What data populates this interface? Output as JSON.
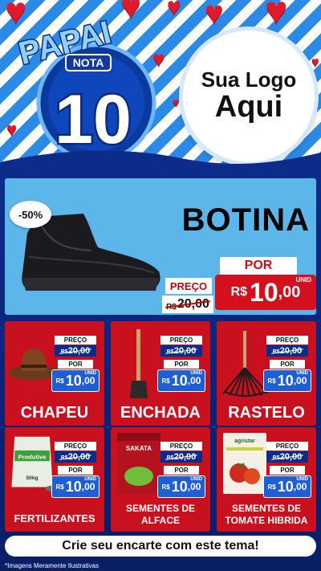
{
  "badge": {
    "line1": "PAPAI",
    "nota": "NOTA",
    "number": "10"
  },
  "logo": {
    "line1": "Sua Logo",
    "line2": "Aqui"
  },
  "featured": {
    "discount": "-50%",
    "name": "BOTINA",
    "preco_label": "PREÇO",
    "old_currency": "R$",
    "old_price": "20,00",
    "por_label": "POR",
    "currency": "R$",
    "price_int": "10",
    "price_dec": ",00",
    "unit": "UNID"
  },
  "tag": {
    "preco_label": "PREÇO",
    "old_currency": "R$",
    "old_price": "20,00",
    "por_label": "POR",
    "currency": "R$",
    "price_int": "10",
    "price_dec": ",00",
    "unit": "UNID"
  },
  "products": [
    {
      "name": "CHAPEU"
    },
    {
      "name": "ENCHADA"
    },
    {
      "name": "RASTELO"
    },
    {
      "name": "FERTILIZANTES",
      "pack_label": "Produtive",
      "pack_weight": "50kg"
    },
    {
      "name_line1": "SEMENTES DE",
      "name_line2": "ALFACE",
      "pack_label": "SAKATA"
    },
    {
      "name_line1": "SEMENTES DE",
      "name_line2": "TOMATE HIBRIDA",
      "pack_label": "agristar"
    }
  ],
  "cta": "Crie seu encarte com este tema!",
  "disclaimer": "*Imagens Meramente Ilustrativas",
  "colors": {
    "red": "#c8101f",
    "blue": "#0d2c8a",
    "light_blue": "#5cb6ea"
  }
}
